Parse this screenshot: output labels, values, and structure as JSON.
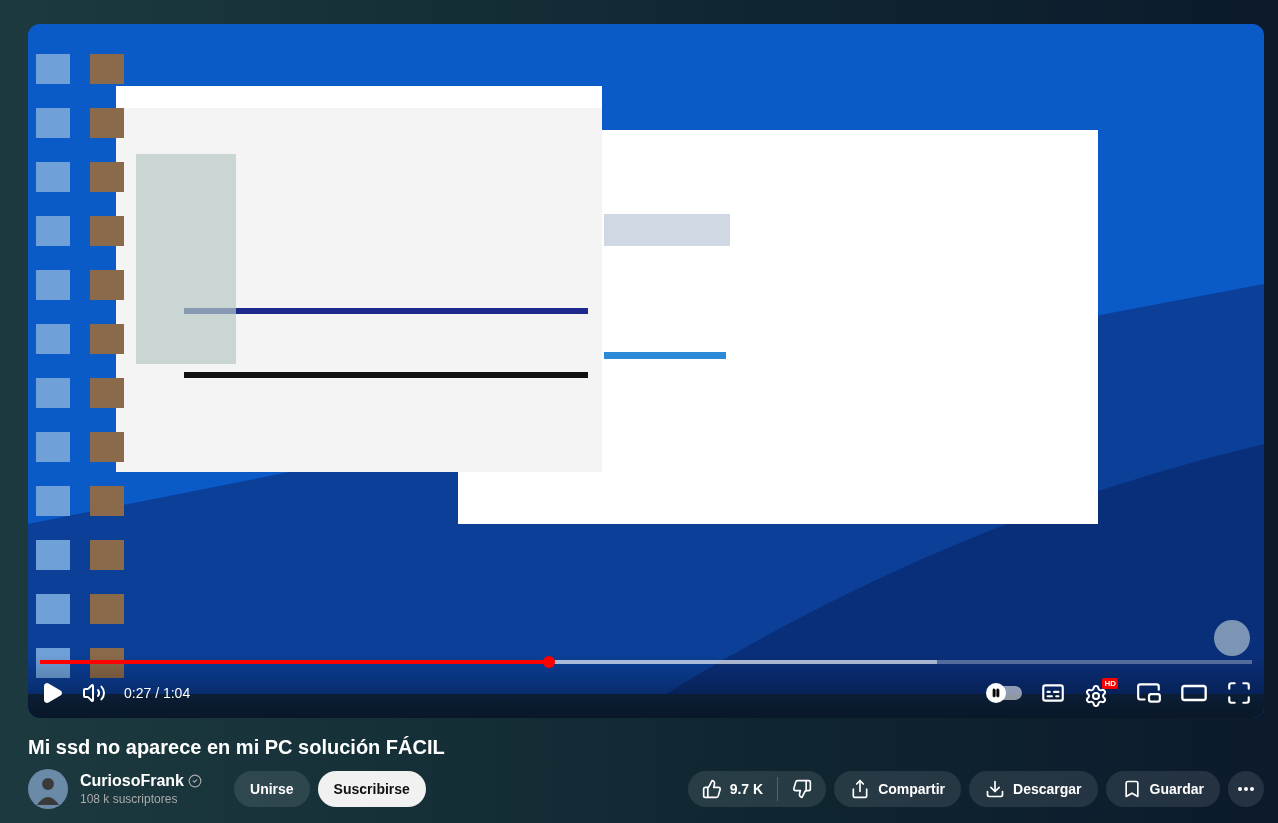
{
  "player": {
    "progress": {
      "level": 0.42
    },
    "buffer": {
      "level": 0.74
    },
    "time": "0:27 / 1:04",
    "autoplay": {
      "on": false
    },
    "quality_badge": "HD"
  },
  "video": {
    "title": "Mi ssd no aparece en mi PC solución FÁCIL"
  },
  "channel": {
    "name": "CuriosoFrank",
    "verified": true,
    "subscribers": "108 k suscriptores"
  },
  "buttons": [
    {
      "kind": "join",
      "label": "Unirse"
    },
    {
      "kind": "subscribe",
      "label": "Suscribirse"
    }
  ],
  "actions": {
    "likes": "9.7 K",
    "items": [
      {
        "kind": "share",
        "label": "Compartir"
      },
      {
        "kind": "download",
        "label": "Descargar"
      },
      {
        "kind": "save",
        "label": "Guardar"
      }
    ]
  }
}
